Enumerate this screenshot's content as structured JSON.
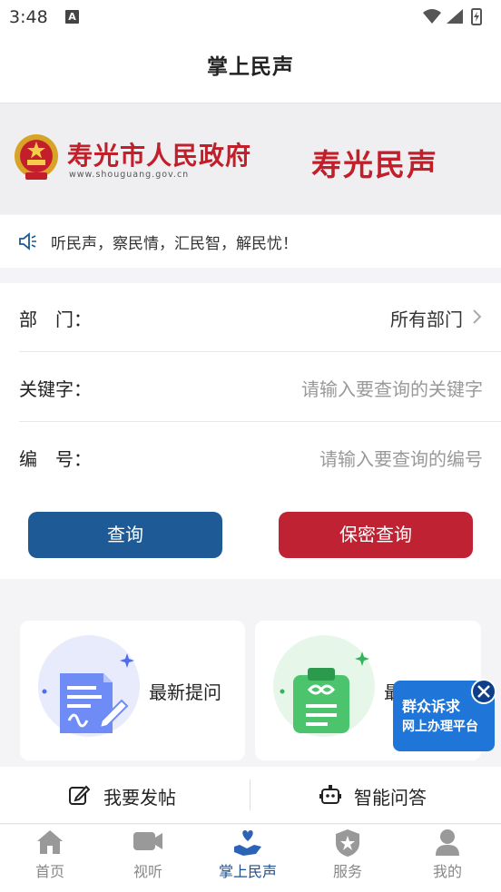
{
  "status_bar": {
    "time": "3:48",
    "badge": "A"
  },
  "header": {
    "title": "掌上民声"
  },
  "banner": {
    "gov_name": "寿光市人民政府",
    "gov_url": "www.shouguang.gov.cn",
    "brand": "寿光民声"
  },
  "notice": {
    "text": "听民声，察民情，汇民智，解民忧！"
  },
  "form": {
    "department_label": "部　门：",
    "department_value": "所有部门",
    "keyword_label": "关键字：",
    "keyword_placeholder": "请输入要查询的关键字",
    "number_label": "编　号：",
    "number_placeholder": "请输入要查询的编号",
    "query_button": "查询",
    "secret_query_button": "保密查询"
  },
  "cards": [
    {
      "label": "最新提问"
    },
    {
      "label": "最"
    }
  ],
  "float_ad": {
    "line1": "群众诉求",
    "line2": "网上办理平台"
  },
  "actions": {
    "post": "我要发帖",
    "qa": "智能问答"
  },
  "tabs": [
    {
      "label": "首页",
      "icon": "home-icon"
    },
    {
      "label": "视听",
      "icon": "video-icon"
    },
    {
      "label": "掌上民声",
      "icon": "heart-hand-icon",
      "active": true
    },
    {
      "label": "服务",
      "icon": "shield-star-icon"
    },
    {
      "label": "我的",
      "icon": "user-icon"
    }
  ],
  "colors": {
    "primary_blue": "#1d5a96",
    "brand_red": "#bf2333",
    "active_tab": "#1f4f8f"
  }
}
